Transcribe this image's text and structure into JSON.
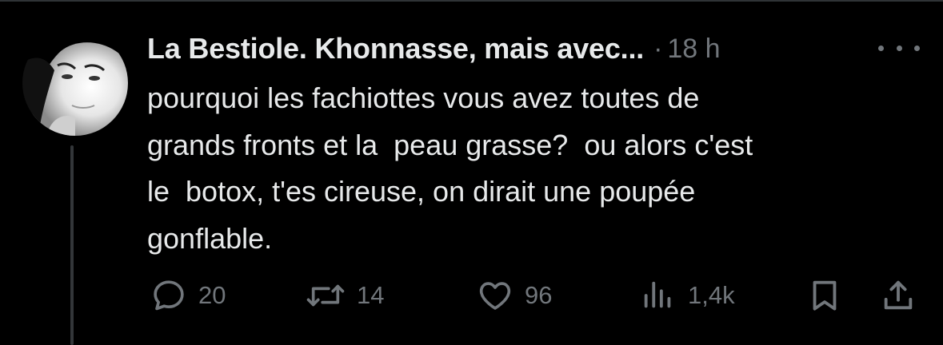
{
  "tweet": {
    "author_name": "La Bestiole. Khonnasse, mais avec...",
    "separator": "·",
    "timestamp": "18 h",
    "text": "pourquoi les fachiottes vous avez toutes de\ngrands fronts et la  peau grasse?  ou alors c'est\nle  botox, t'es cireuse, on dirait une poupée\ngonflable.",
    "avatar_icon": "profile-photo-icon",
    "more_icon": "more-horizontal-icon"
  },
  "actions": {
    "reply": {
      "icon": "reply-icon",
      "count": "20"
    },
    "repost": {
      "icon": "repost-icon",
      "count": "14"
    },
    "like": {
      "icon": "heart-icon",
      "count": "96"
    },
    "views": {
      "icon": "views-icon",
      "count": "1,4k"
    },
    "bookmark": {
      "icon": "bookmark-icon"
    },
    "share": {
      "icon": "share-icon"
    }
  },
  "colors": {
    "background": "#000000",
    "primary_text": "#e7e9ea",
    "secondary_text": "#71767b",
    "thread_line": "#333639"
  }
}
